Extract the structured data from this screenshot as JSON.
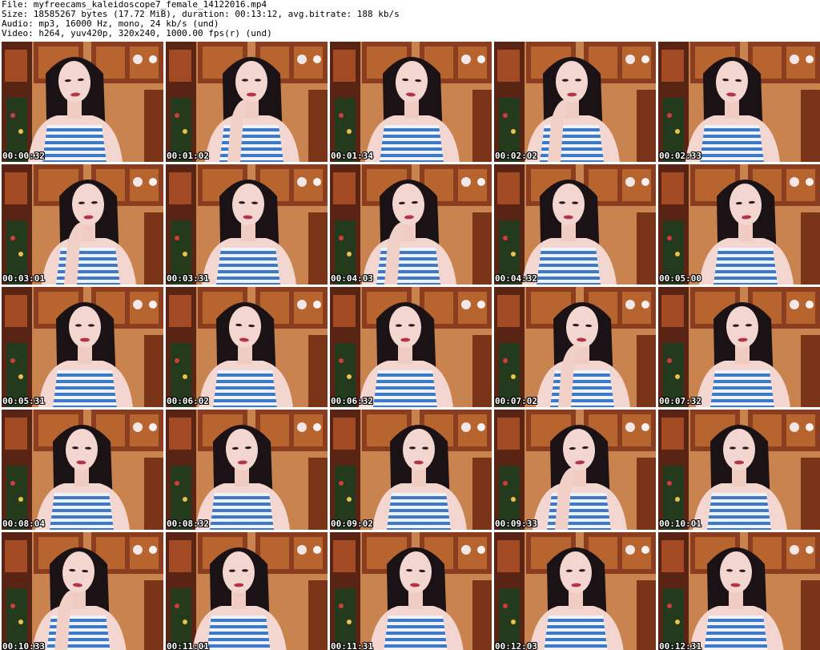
{
  "header": {
    "file": "File: myfreecams_kaleidoscope7_female_14122016.mp4",
    "size": "Size: 18585267 bytes (17.72 MiB), duration: 00:13:12, avg.bitrate: 188 kb/s",
    "audio": "Audio: mp3, 16000 Hz, mono, 24 kb/s (und)",
    "video": "Video: h264, yuv420p, 320x240, 1000.00 fps(r) (und)"
  },
  "colors": {
    "background": "#ffffff",
    "header_text": "#000000",
    "timestamp_text": "#ffffff",
    "timestamp_outline": "#000000",
    "wall": "#c9834e",
    "cabinet": "#8a3e1f",
    "hair": "#1b1216",
    "skin": "#f3d6cf",
    "stripe_blue": "#3f78c6",
    "stripe_white": "#eef3fb"
  },
  "frames": [
    {
      "time": "00:00:32",
      "icon": "video-frame-thumbnail"
    },
    {
      "time": "00:01:02",
      "icon": "video-frame-thumbnail"
    },
    {
      "time": "00:01:34",
      "icon": "video-frame-thumbnail"
    },
    {
      "time": "00:02:02",
      "icon": "video-frame-thumbnail"
    },
    {
      "time": "00:02:33",
      "icon": "video-frame-thumbnail"
    },
    {
      "time": "00:03:01",
      "icon": "video-frame-thumbnail"
    },
    {
      "time": "00:03:31",
      "icon": "video-frame-thumbnail"
    },
    {
      "time": "00:04:03",
      "icon": "video-frame-thumbnail"
    },
    {
      "time": "00:04:32",
      "icon": "video-frame-thumbnail"
    },
    {
      "time": "00:05:00",
      "icon": "video-frame-thumbnail"
    },
    {
      "time": "00:05:31",
      "icon": "video-frame-thumbnail"
    },
    {
      "time": "00:06:02",
      "icon": "video-frame-thumbnail"
    },
    {
      "time": "00:06:32",
      "icon": "video-frame-thumbnail"
    },
    {
      "time": "00:07:02",
      "icon": "video-frame-thumbnail"
    },
    {
      "time": "00:07:32",
      "icon": "video-frame-thumbnail"
    },
    {
      "time": "00:08:04",
      "icon": "video-frame-thumbnail"
    },
    {
      "time": "00:08:32",
      "icon": "video-frame-thumbnail"
    },
    {
      "time": "00:09:02",
      "icon": "video-frame-thumbnail"
    },
    {
      "time": "00:09:33",
      "icon": "video-frame-thumbnail"
    },
    {
      "time": "00:10:01",
      "icon": "video-frame-thumbnail"
    },
    {
      "time": "00:10:33",
      "icon": "video-frame-thumbnail"
    },
    {
      "time": "00:11:01",
      "icon": "video-frame-thumbnail"
    },
    {
      "time": "00:11:31",
      "icon": "video-frame-thumbnail"
    },
    {
      "time": "00:12:03",
      "icon": "video-frame-thumbnail"
    },
    {
      "time": "00:12:31",
      "icon": "video-frame-thumbnail"
    }
  ]
}
